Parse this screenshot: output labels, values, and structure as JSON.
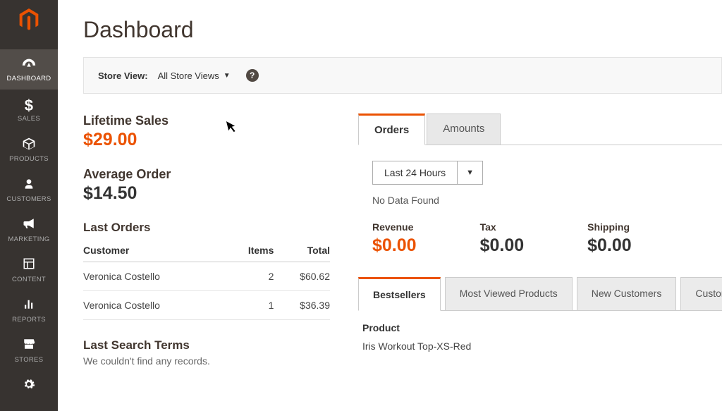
{
  "page_title": "Dashboard",
  "sidebar": {
    "items": [
      {
        "label": "DASHBOARD",
        "icon": "gauge"
      },
      {
        "label": "SALES",
        "icon": "dollar"
      },
      {
        "label": "PRODUCTS",
        "icon": "box"
      },
      {
        "label": "CUSTOMERS",
        "icon": "person"
      },
      {
        "label": "MARKETING",
        "icon": "megaphone"
      },
      {
        "label": "CONTENT",
        "icon": "layout"
      },
      {
        "label": "REPORTS",
        "icon": "bars"
      },
      {
        "label": "STORES",
        "icon": "storefront"
      },
      {
        "label": "",
        "icon": "gear"
      }
    ]
  },
  "store_view": {
    "label": "Store View:",
    "selected": "All Store Views"
  },
  "lifetime_sales": {
    "label": "Lifetime Sales",
    "value": "$29.00"
  },
  "average_order": {
    "label": "Average Order",
    "value": "$14.50"
  },
  "last_orders": {
    "title": "Last Orders",
    "cols": {
      "customer": "Customer",
      "items": "Items",
      "total": "Total"
    },
    "rows": [
      {
        "customer": "Veronica Costello",
        "items": "2",
        "total": "$60.62"
      },
      {
        "customer": "Veronica Costello",
        "items": "1",
        "total": "$36.39"
      }
    ]
  },
  "last_search": {
    "title": "Last Search Terms",
    "empty": "We couldn't find any records."
  },
  "chart_tabs": {
    "orders": "Orders",
    "amounts": "Amounts"
  },
  "timeframe": "Last 24 Hours",
  "nodata": "No Data Found",
  "stats": {
    "revenue": {
      "label": "Revenue",
      "value": "$0.00"
    },
    "tax": {
      "label": "Tax",
      "value": "$0.00"
    },
    "shipping": {
      "label": "Shipping",
      "value": "$0.00"
    }
  },
  "bottom_tabs": {
    "bestsellers": "Bestsellers",
    "most_viewed": "Most Viewed Products",
    "new_customers": "New Customers",
    "customers": "Customers"
  },
  "bestsellers": {
    "col": "Product",
    "row1": "Iris Workout Top-XS-Red"
  }
}
